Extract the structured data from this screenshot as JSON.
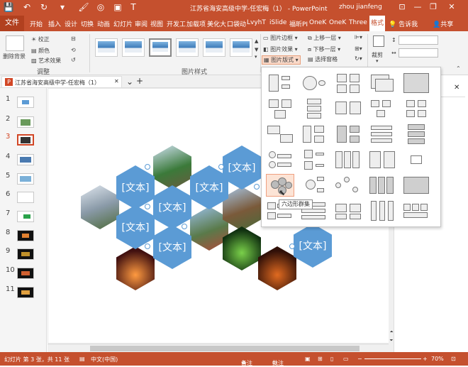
{
  "window": {
    "title": "江苏省海安高级中学-任宏梅（1）",
    "app": "PowerPoint",
    "user": "zhou jianfeng",
    "min": "—",
    "restore": "❐",
    "close": "✕"
  },
  "tabs": {
    "file": "文件",
    "items": [
      "开始",
      "插入",
      "设计",
      "切换",
      "动画",
      "幻灯片",
      "审阅",
      "视图",
      "开发工",
      "加载项",
      "美化大",
      "口袋动",
      "LvyhT",
      "iSlide",
      "福昕PI",
      "OneK",
      "OneK",
      "Three"
    ],
    "active": "格式",
    "search": "告诉我",
    "share": "共享"
  },
  "ribbon": {
    "remove_bg": "删除背景",
    "correct": "校正",
    "color": "颜色",
    "art_effects": "艺术效果",
    "adjust_label": "调整",
    "styles_label": "图片样式",
    "border": "图片边框",
    "effects": "图片效果",
    "layout": "图片版式",
    "bring_forward": "上移一层",
    "send_backward": "下移一层",
    "selection_pane": "选择窗格",
    "crop": "裁剪",
    "height": "",
    "width": ""
  },
  "doc_tab": {
    "name": "江苏省海安高级中学-任宏梅（1）",
    "close": "✕",
    "add": "+"
  },
  "thumbnails": [
    "1",
    "2",
    "3",
    "4",
    "5",
    "6",
    "7",
    "8",
    "9",
    "10",
    "11"
  ],
  "slide": {
    "placeholder": "[文本]"
  },
  "gallery": {
    "tooltip": "六边形群集"
  },
  "status": {
    "slide_info": "幻灯片 第 3 张，共 11 张",
    "language": "中文(中国)",
    "notes": "备注",
    "comments": "批注",
    "zoom": "70%"
  },
  "colors": {
    "accent": "#c5502e",
    "hex_fill": "#5b9bd5"
  }
}
